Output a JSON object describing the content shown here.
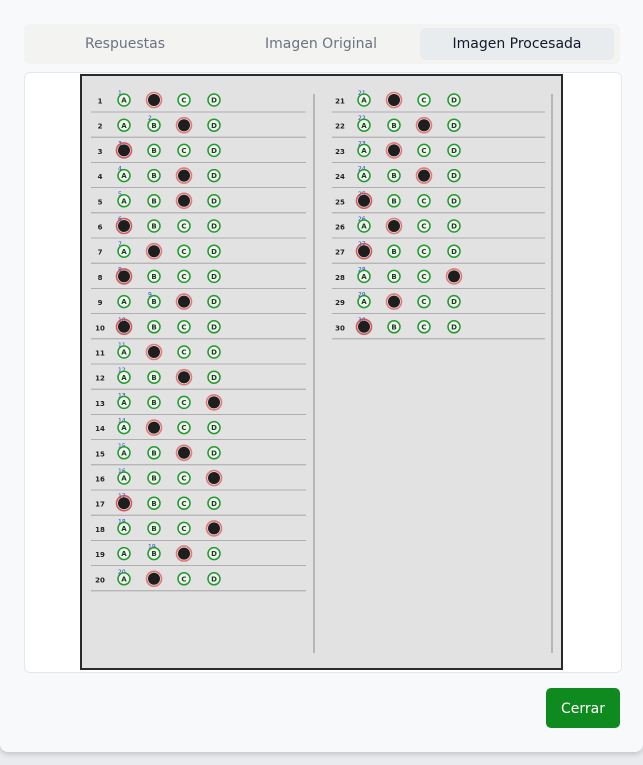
{
  "tabs": [
    {
      "label": "Respuestas",
      "active": false
    },
    {
      "label": "Imagen Original",
      "active": false
    },
    {
      "label": "Imagen Procesada",
      "active": true
    }
  ],
  "footer": {
    "close_label": "Cerrar"
  },
  "colors": {
    "accent": "#0f8a1f",
    "correct_ring": "#1f9b2a",
    "mark_red": "#d23a3a",
    "question_num": "#2446c8"
  },
  "sheet": {
    "options": [
      "A",
      "B",
      "C",
      "D"
    ],
    "questions": [
      {
        "n": "1",
        "marked": "B",
        "correct": "A"
      },
      {
        "n": "2",
        "marked": "C",
        "correct": "B"
      },
      {
        "n": "3",
        "marked": "A",
        "correct": "A"
      },
      {
        "n": "4",
        "marked": "C",
        "correct": "A"
      },
      {
        "n": "5",
        "marked": "C",
        "correct": "A"
      },
      {
        "n": "6",
        "marked": "A",
        "correct": "A"
      },
      {
        "n": "7",
        "marked": "B",
        "correct": "A"
      },
      {
        "n": "8",
        "marked": "A",
        "correct": "A"
      },
      {
        "n": "9",
        "marked": "C",
        "correct": "B"
      },
      {
        "n": "10",
        "marked": "A",
        "correct": "A"
      },
      {
        "n": "11",
        "marked": "B",
        "correct": "A"
      },
      {
        "n": "12",
        "marked": "C",
        "correct": "A"
      },
      {
        "n": "13",
        "marked": "D",
        "correct": "A"
      },
      {
        "n": "14",
        "marked": "B",
        "correct": "A"
      },
      {
        "n": "15",
        "marked": "C",
        "correct": "A"
      },
      {
        "n": "16",
        "marked": "D",
        "correct": "A"
      },
      {
        "n": "17",
        "marked": "A",
        "correct": "A"
      },
      {
        "n": "18",
        "marked": "D",
        "correct": "A"
      },
      {
        "n": "19",
        "marked": "C",
        "correct": "B"
      },
      {
        "n": "20",
        "marked": "B",
        "correct": "A"
      },
      {
        "n": "21",
        "marked": "B",
        "correct": "A"
      },
      {
        "n": "22",
        "marked": "C",
        "correct": "A"
      },
      {
        "n": "23",
        "marked": "B",
        "correct": "A"
      },
      {
        "n": "24",
        "marked": "C",
        "correct": "A"
      },
      {
        "n": "25",
        "marked": "A",
        "correct": "A"
      },
      {
        "n": "26",
        "marked": "B",
        "correct": "A"
      },
      {
        "n": "27",
        "marked": "A",
        "correct": "A"
      },
      {
        "n": "28",
        "marked": "D",
        "correct": "A"
      },
      {
        "n": "29",
        "marked": "B",
        "correct": "A"
      },
      {
        "n": "30",
        "marked": "A",
        "correct": "A"
      }
    ]
  }
}
